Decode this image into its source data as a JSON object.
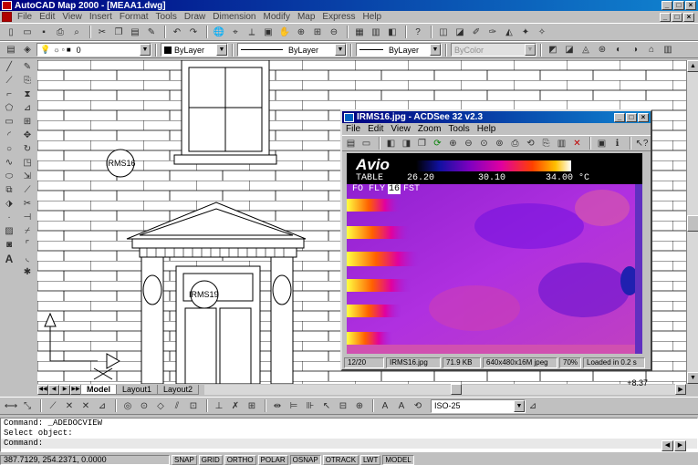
{
  "app": {
    "title": "AutoCAD Map 2000 - [MEAA1.dwg]",
    "menu": [
      "File",
      "Edit",
      "View",
      "Insert",
      "Format",
      "Tools",
      "Draw",
      "Dimension",
      "Modify",
      "Map",
      "Express",
      "Help"
    ]
  },
  "toolbar_layers": {
    "layer_value": "0",
    "color_value": "ByLayer",
    "linetype_value": "ByLayer",
    "lineweight_value": "ByLayer",
    "plotstyle_value": "ByColor"
  },
  "drawing": {
    "labels": [
      "IRMS16",
      "IRMS19"
    ],
    "coordinate_text": "+8.37",
    "layout_tabs": [
      "Model",
      "Layout1",
      "Layout2"
    ],
    "active_tab": "Model"
  },
  "dimstyle": {
    "value": "ISO-25"
  },
  "command_lines": [
    "Command: _ADEDOCVIEW",
    "Select object:",
    "Command:"
  ],
  "status": {
    "coords": "387.7129, 254.2371, 0.0000",
    "toggles": [
      "SNAP",
      "GRID",
      "ORTHO",
      "POLAR",
      "OSNAP",
      "OTRACK",
      "LWT",
      "MODEL"
    ],
    "active_toggles": [
      "OSNAP",
      "MODEL"
    ]
  },
  "acdsee": {
    "title": "IRMS16.jpg - ACDSee 32 v2.3",
    "menu": [
      "File",
      "Edit",
      "View",
      "Zoom",
      "Tools",
      "Help"
    ],
    "image_overlay": {
      "brand": "Avio",
      "scale_label": "TABLE",
      "scale_min": "26.20",
      "scale_mid": "30.10",
      "scale_max": "34.00 °C",
      "mode": "FO FLY",
      "mode_badge": "16",
      "mode_suffix": "FST"
    },
    "statusbar": {
      "index": "12/20",
      "filename": "IRMS16.jpg",
      "filesize": "71.9 KB",
      "dimensions": "640x480x16M jpeg",
      "zoom": "70%",
      "loadtime": "Loaded in 0.2 s"
    }
  },
  "colors": {
    "titlebar": "#000080",
    "thermal_hot": "#ffff00",
    "thermal_mid": "#c000ff",
    "thermal_cool": "#2020c0"
  }
}
